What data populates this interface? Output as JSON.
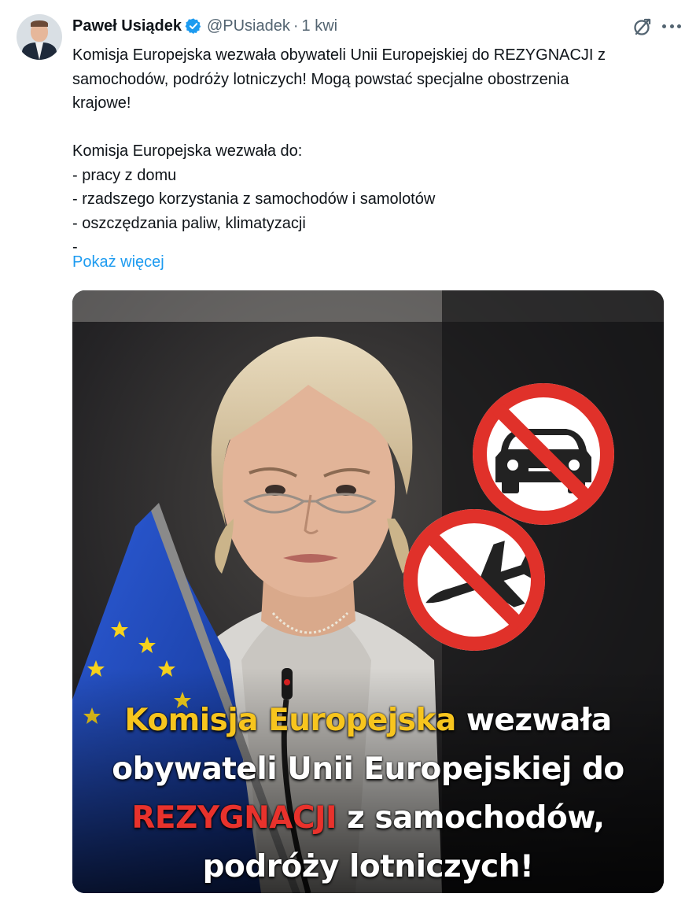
{
  "author": {
    "name": "Paweł Usiądek",
    "handle": "@PUsiadek",
    "separator": "·",
    "time": "1 kwi"
  },
  "icons": {
    "avatar": "profile-photo",
    "verified": "verified-badge-icon",
    "grok": "grok-icon",
    "more": "more-options-icon"
  },
  "colors": {
    "text": "#0f1419",
    "muted": "#536471",
    "link": "#1d9bf0",
    "verified": "#1d9bf0",
    "caption_yellow": "#f7c51e",
    "caption_red": "#e8322c",
    "prohibition_red": "#e0312a"
  },
  "tweet": {
    "lines": [
      "Komisja Europejska wezwała obywateli Unii Europejskiej do REZYGNACJI z",
      "samochodów, podróży lotniczych! Mogą powstać specjalne obostrzenia",
      "krajowe!",
      "",
      "Komisja Europejska wezwała do:",
      "- pracy z domu",
      "- rzadszego korzystania z samochodów i samolotów",
      "- oszczędzania paliw, klimatyzacji",
      "-"
    ],
    "show_more": "Pokaż więcej"
  },
  "image": {
    "caption": {
      "l1_yellow": "Komisja Europejska",
      "l1_white": " wezwała",
      "l2": "obywateli Unii Europejskiej do",
      "l3_red": "REZYGNACJI",
      "l3_white": " z samochodów,",
      "l4": "podróży lotniczych!"
    },
    "signs": [
      "no-car-sign",
      "no-airplane-sign"
    ]
  }
}
